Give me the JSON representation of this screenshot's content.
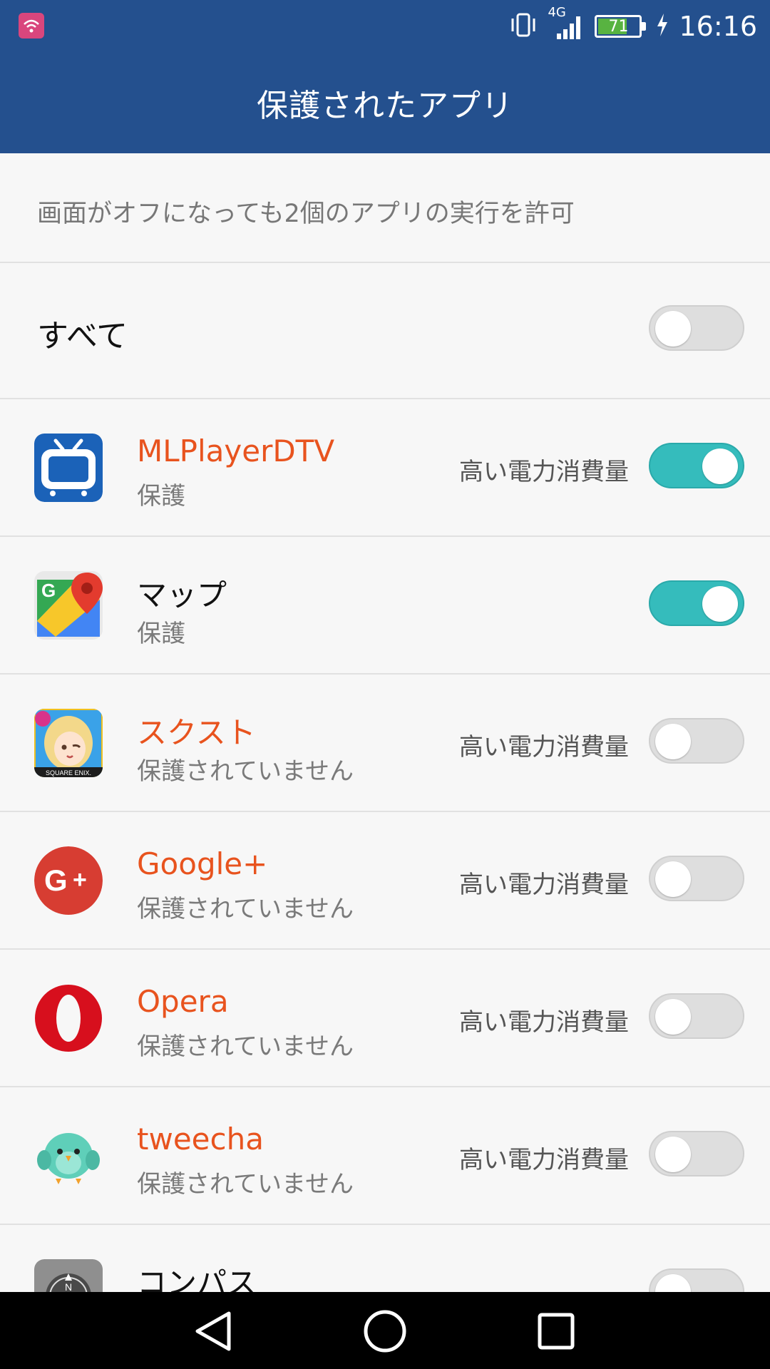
{
  "status_bar": {
    "time": "16:16",
    "network": "4G",
    "battery_level": "71",
    "battery_color": "#58b341",
    "icons": [
      "notification-icon",
      "vibrate-icon",
      "signal-icon",
      "battery-icon",
      "charging-icon"
    ]
  },
  "header": {
    "title": "保護されたアプリ",
    "color": "#24508e"
  },
  "description": "画面がオフになっても2個のアプリの実行を許可",
  "all_row": {
    "label": "すべて",
    "enabled": false
  },
  "apps": [
    {
      "name": "MLPlayerDTV",
      "status": "保護",
      "power": "高い電力消費量",
      "enabled": true,
      "warn": true,
      "icon": "tv-icon"
    },
    {
      "name": "マップ",
      "status": "保護",
      "power": "",
      "enabled": true,
      "warn": false,
      "icon": "maps-icon"
    },
    {
      "name": "スクスト",
      "status": "保護されていません",
      "power": "高い電力消費量",
      "enabled": false,
      "warn": true,
      "icon": "game-icon"
    },
    {
      "name": "Google+",
      "status": "保護されていません",
      "power": "高い電力消費量",
      "enabled": false,
      "warn": true,
      "icon": "google-plus-icon"
    },
    {
      "name": "Opera",
      "status": "保護されていません",
      "power": "高い電力消費量",
      "enabled": false,
      "warn": true,
      "icon": "opera-icon"
    },
    {
      "name": "tweecha",
      "status": "保護されていません",
      "power": "高い電力消費量",
      "enabled": false,
      "warn": true,
      "icon": "bird-icon"
    },
    {
      "name": "コンパス",
      "status": "",
      "power": "",
      "enabled": false,
      "warn": false,
      "icon": "compass-icon"
    }
  ],
  "colors": {
    "accent_toggle": "#35bcbc",
    "warning_text": "#e8531e"
  },
  "navbar": {
    "icons": [
      "back-icon",
      "home-icon",
      "recents-icon"
    ]
  }
}
